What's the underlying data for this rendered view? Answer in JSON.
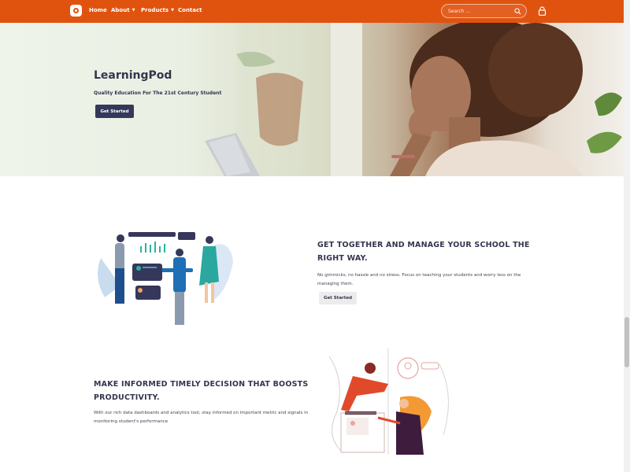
{
  "nav": {
    "items": [
      {
        "label": "Home",
        "has_caret": false
      },
      {
        "label": "About",
        "has_caret": true
      },
      {
        "label": "Products",
        "has_caret": true
      },
      {
        "label": "Contact",
        "has_caret": false
      }
    ],
    "search_placeholder": "Search ...",
    "brand_color": "#e0530f",
    "icons": [
      "logo-icon",
      "search-icon",
      "lock-icon",
      "chevron-down-icon"
    ]
  },
  "hero": {
    "title": "LearningPod",
    "subtitle": "Quality Education For The 21st Century Student",
    "button_label": "Get Started"
  },
  "section1": {
    "title_line1": "GET TOGETHER AND MANAGE YOUR SCHOOL THE",
    "title_line2": "RIGHT WAY.",
    "text_line1": "No gimmicks, no hassle and no stress. Focus on teaching your students and worry less on the",
    "text_line2": "managing them.",
    "button_label": "Get Started"
  },
  "section2": {
    "title_line1": "MAKE INFORMED TIMELY DECISION THAT BOOSTS",
    "title_line2": "PRODUCTIVITY.",
    "text_line1": "With our rich data dashboards and analytics tool, stay informed on important metric and signals in",
    "text_line2": "monitoring student's performance"
  },
  "colors": {
    "accent": "#e0530f",
    "dark_button": "#35385a",
    "heading": "#33364d"
  }
}
